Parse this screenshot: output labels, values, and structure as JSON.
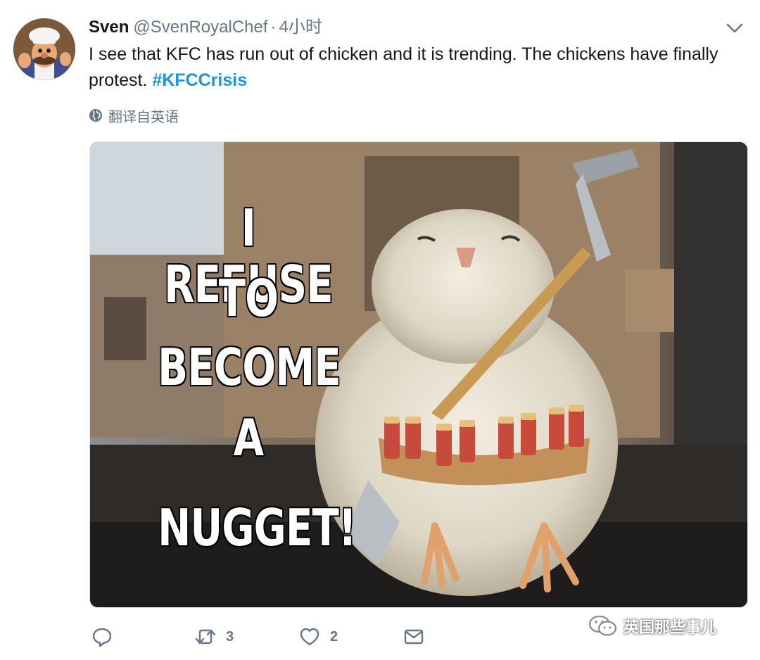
{
  "tweet": {
    "name": "Sven",
    "handle": "@SvenRoyalChef",
    "dot": "·",
    "time": "4小时",
    "text": "I see that KFC has run out of chicken and it is trending.  The chickens have finally protest.",
    "hashtag": "#KFCCrisis",
    "translate_label": "翻译自英语"
  },
  "media": {
    "meme_lines": [
      "I REFUSE",
      "TO",
      "BECOME",
      "A",
      "NUGGET!"
    ]
  },
  "actions": {
    "reply_count": "",
    "retweet_count": "3",
    "like_count": "2"
  },
  "watermark": {
    "label": "英国那些事儿"
  },
  "icons": {
    "avatar": "avatar",
    "caret": "chevron-down-icon",
    "translate": "globe-icon",
    "reply": "reply-icon",
    "retweet": "retweet-icon",
    "like": "heart-icon",
    "dm": "envelope-icon",
    "watermark": "wechat-icon"
  },
  "colors": {
    "text": "#14171a",
    "secondary": "#657786",
    "hashtag": "#1b95e0"
  }
}
